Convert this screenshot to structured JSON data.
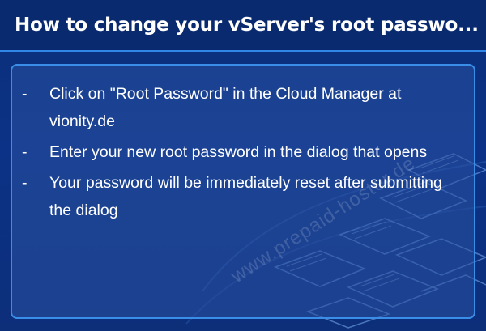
{
  "header": {
    "title": "How to change your vServer's root passwo..."
  },
  "content": {
    "bullet_marker": "-",
    "items": [
      "Click on \"Root Password\" in the Cloud Manager at vionity.de",
      "Enter your new root password in the dialog that opens",
      "Your password will be immediately reset after submitting the dialog"
    ]
  },
  "watermark": {
    "text": "www.prepaid-hoster.de"
  },
  "colors": {
    "background": "#0b2f78",
    "header_background": "#0a2a6f",
    "accent_border": "#2f86e6",
    "panel_fill": "#2a50a0",
    "text": "#ffffff"
  }
}
